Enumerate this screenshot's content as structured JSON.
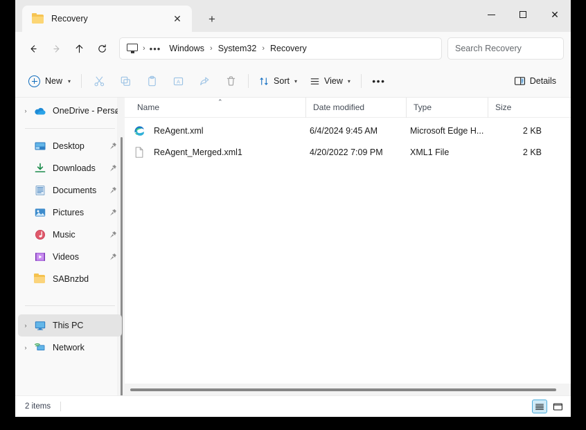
{
  "window": {
    "controls": {
      "minimize": "minimize",
      "maximize": "maximize",
      "close": "close"
    }
  },
  "tabs": {
    "items": [
      {
        "title": "Recovery",
        "icon": "folder-icon",
        "close_label": "✕"
      }
    ],
    "new_tab_label": "+"
  },
  "nav": {
    "back_label": "Back",
    "forward_label": "Forward",
    "up_label": "Up",
    "refresh_label": "Refresh",
    "breadcrumb": {
      "root_icon": "this-pc-icon",
      "overflow": "•••",
      "items": [
        "Windows",
        "System32",
        "Recovery"
      ],
      "separator": "›"
    },
    "search": {
      "placeholder": "Search Recovery",
      "value": "Search Recovery"
    }
  },
  "toolbar": {
    "new_label": "New",
    "chevron": "⌄",
    "cut_label": "Cut",
    "copy_label": "Copy",
    "paste_label": "Paste",
    "rename_label": "Rename",
    "share_label": "Share",
    "delete_label": "Delete",
    "sort_label": "Sort",
    "view_label": "View",
    "more_label": "•••",
    "details_label": "Details"
  },
  "sidebar": {
    "items": [
      {
        "label": "OneDrive - Persø",
        "icon": "onedrive-icon",
        "expander": "›",
        "pinned": false,
        "selected": false
      },
      {
        "label": "Desktop",
        "icon": "desktop-icon",
        "expander": "",
        "pinned": true,
        "selected": false
      },
      {
        "label": "Downloads",
        "icon": "downloads-icon",
        "expander": "",
        "pinned": true,
        "selected": false
      },
      {
        "label": "Documents",
        "icon": "documents-icon",
        "expander": "",
        "pinned": true,
        "selected": false
      },
      {
        "label": "Pictures",
        "icon": "pictures-icon",
        "expander": "",
        "pinned": true,
        "selected": false
      },
      {
        "label": "Music",
        "icon": "music-icon",
        "expander": "",
        "pinned": true,
        "selected": false
      },
      {
        "label": "Videos",
        "icon": "videos-icon",
        "expander": "",
        "pinned": true,
        "selected": false
      },
      {
        "label": "SABnzbd",
        "icon": "folder-icon",
        "expander": "",
        "pinned": false,
        "selected": false
      },
      {
        "label": "This PC",
        "icon": "this-pc-icon",
        "expander": "›",
        "pinned": false,
        "selected": true
      },
      {
        "label": "Network",
        "icon": "network-icon",
        "expander": "›",
        "pinned": false,
        "selected": false
      }
    ],
    "pin_glyph": "📌"
  },
  "filelist": {
    "columns": [
      {
        "label": "Name",
        "sorted": true,
        "sort_caret": "⌃"
      },
      {
        "label": "Date modified",
        "sorted": false,
        "sort_caret": ""
      },
      {
        "label": "Type",
        "sorted": false,
        "sort_caret": ""
      },
      {
        "label": "Size",
        "sorted": false,
        "sort_caret": ""
      }
    ],
    "rows": [
      {
        "name": "ReAgent.xml",
        "date_modified": "6/4/2024 9:45 AM",
        "type": "Microsoft Edge H...",
        "size": "2 KB",
        "icon": "edge-icon"
      },
      {
        "name": "ReAgent_Merged.xml1",
        "date_modified": "4/20/2022 7:09 PM",
        "type": "XML1 File",
        "size": "2 KB",
        "icon": "generic-file-icon"
      }
    ]
  },
  "statusbar": {
    "item_count": "2 items",
    "details_view_label": "Details view",
    "large_icons_view_label": "Large icons view"
  },
  "colors": {
    "accent": "#0f6cbd",
    "selection": "#cfeaf7",
    "selection_border": "#4aabdb",
    "folder_yellow": "#f5c24f",
    "chrome_bg": "#f9f9f9",
    "tabstrip_bg": "#e9e9e9"
  }
}
